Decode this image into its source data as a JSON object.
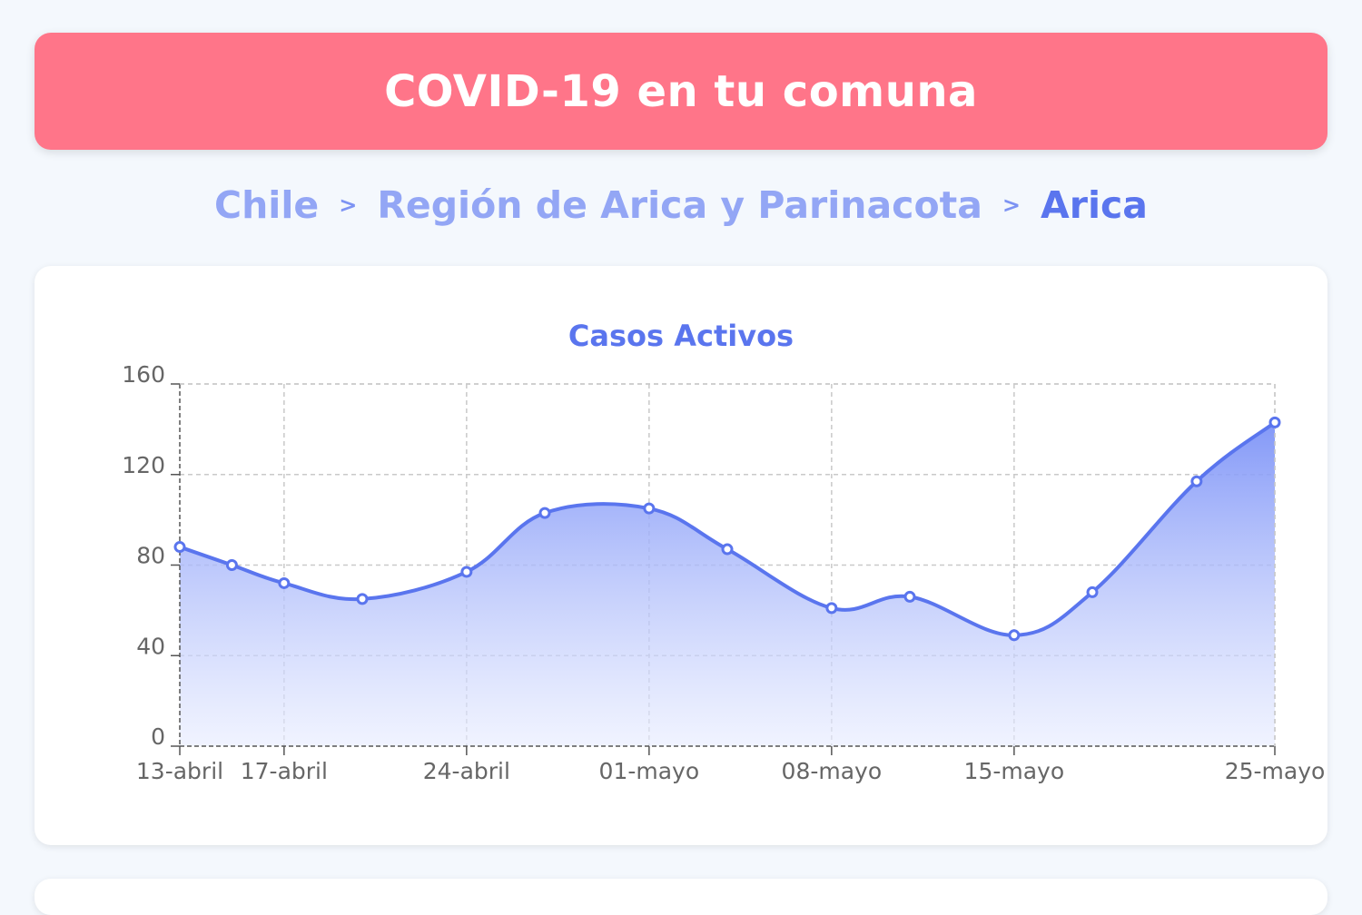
{
  "header": {
    "title": "COVID-19 en tu comuna"
  },
  "breadcrumb": {
    "items": [
      "Chile",
      "Región de Arica y Parinacota",
      "Arica"
    ],
    "separator": ">"
  },
  "colors": {
    "banner": "#ff7589",
    "accent": "#5a75ee",
    "breadcrumb_link": "#93a6f5"
  },
  "chart_data": {
    "type": "area",
    "title": "Casos Activos",
    "xlabel": "",
    "ylabel": "",
    "x": [
      "13-abril",
      "15-abril",
      "17-abril",
      "20-abril",
      "24-abril",
      "27-abril",
      "01-mayo",
      "04-mayo",
      "08-mayo",
      "11-mayo",
      "15-mayo",
      "18-mayo",
      "22-mayo",
      "25-mayo"
    ],
    "values": [
      88,
      80,
      72,
      65,
      77,
      103,
      105,
      87,
      61,
      66,
      49,
      68,
      117,
      143
    ],
    "ylim": [
      0,
      160
    ],
    "yticks": [
      0,
      40,
      80,
      120,
      160
    ],
    "xtick_labels": [
      "13-abril",
      "17-abril",
      "24-abril",
      "01-mayo",
      "08-mayo",
      "15-mayo",
      "25-mayo"
    ],
    "grid": true,
    "line_color": "#5a75ee"
  }
}
